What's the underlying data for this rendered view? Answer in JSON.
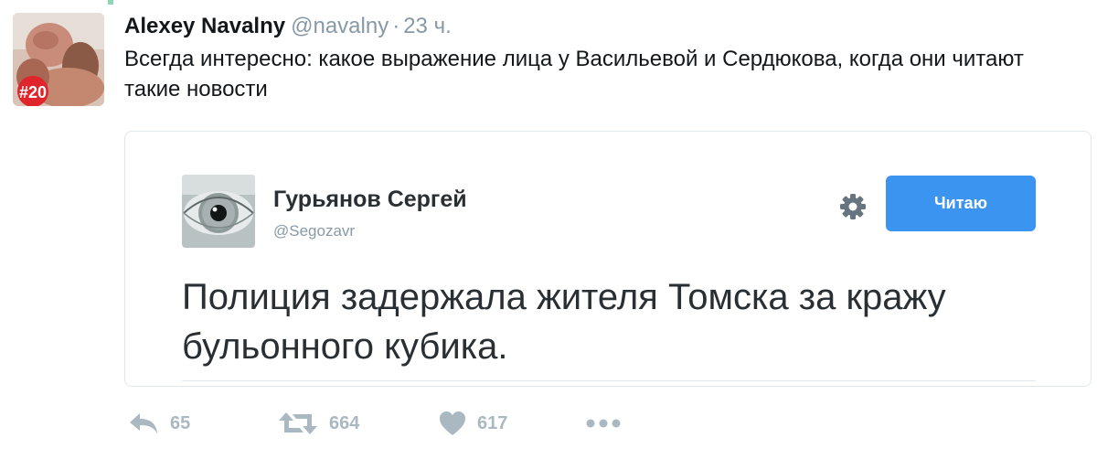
{
  "tweet": {
    "author_name": "Alexey Navalny",
    "handle": "@navalny",
    "separator": "·",
    "time": "23 ч.",
    "avatar_badge": "#20",
    "text": "Всегда интересно: какое выражение лица у Васильевой и Сердюкова, когда они читают такие новости"
  },
  "quoted": {
    "author_name": "Гурьянов Сергей",
    "handle": "@Segozavr",
    "follow_label": "Читаю",
    "text": "Полиция задержала жителя Томска за кражу бульонного кубика."
  },
  "actions": {
    "reply_count": "65",
    "retweet_count": "664",
    "like_count": "617"
  },
  "colors": {
    "follow_button": "#3b94f0",
    "muted_text": "#8899a6",
    "action_icons": "#aab8c2"
  },
  "icons": [
    "reply-icon",
    "retweet-icon",
    "heart-icon",
    "more-icon",
    "gear-icon"
  ]
}
